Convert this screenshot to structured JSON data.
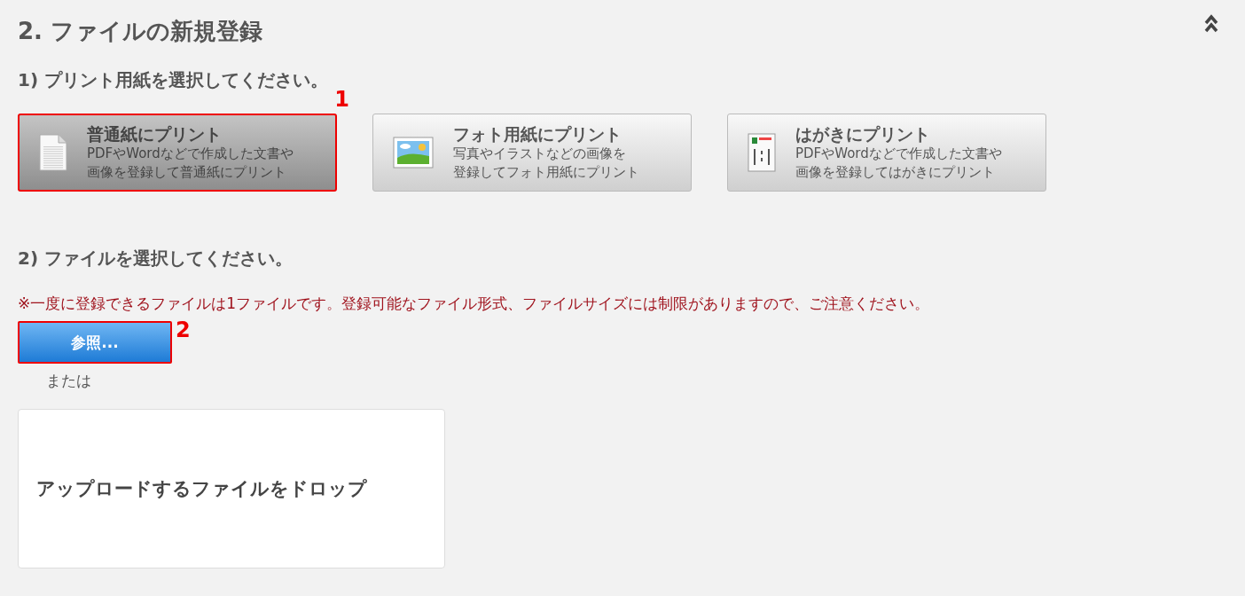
{
  "title": "2. ファイルの新規登録",
  "step1": {
    "heading": "1) プリント用紙を選択してください。",
    "options": [
      {
        "kind": "document",
        "title": "普通紙にプリント",
        "description_lines": [
          "PDFやWordなどで作成した文書や",
          "画像を登録して普通紙にプリント"
        ],
        "selected": true,
        "callout": "1"
      },
      {
        "kind": "photo",
        "title": "フォト用紙にプリント",
        "description_lines": [
          "写真やイラストなどの画像を",
          "登録してフォト用紙にプリント"
        ],
        "selected": false
      },
      {
        "kind": "postcard",
        "title": "はがきにプリント",
        "description_lines": [
          "PDFやWordなどで作成した文書や",
          "画像を登録してはがきにプリント"
        ],
        "selected": false
      }
    ]
  },
  "step2": {
    "heading": "2) ファイルを選択してください。",
    "note": "※一度に登録できるファイルは1ファイルです。登録可能なファイル形式、ファイルサイズには制限がありますので、ご注意ください。",
    "browse_button": {
      "label": "参照...",
      "callout": "2"
    },
    "or_text": "または",
    "drop_zone": "アップロードするファイルをドロップ"
  }
}
